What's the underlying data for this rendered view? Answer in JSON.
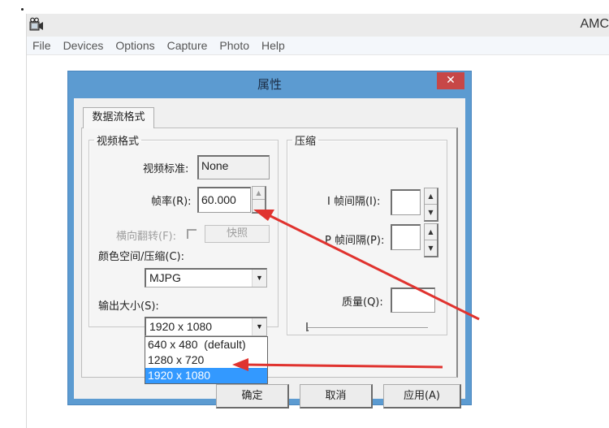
{
  "app": {
    "title": "AMC",
    "menu": [
      "File",
      "Devices",
      "Options",
      "Capture",
      "Photo",
      "Help"
    ]
  },
  "dialog": {
    "title": "属性",
    "close_label": "✕",
    "tab_label": "数据流格式",
    "video_group": {
      "legend": "视频格式",
      "standard_label": "视频标准:",
      "standard_value": "None",
      "framerate_label": "帧率(R):",
      "framerate_value": "60.000",
      "flip_label": "横向翻转(F):",
      "snapshot_label": "快照",
      "colorspace_label": "颜色空间/压缩(C):",
      "colorspace_value": "MJPG",
      "output_size_label": "输出大小(S):",
      "output_size_value": "1920 x 1080",
      "output_size_options": [
        "640 x 480  (default)",
        "1280 x 720",
        "1920 x 1080"
      ],
      "output_size_selected_index": 2
    },
    "compression_group": {
      "legend": "压缩",
      "i_frame_label": "I 帧间隔(I):",
      "i_frame_value": "",
      "p_frame_label": "P 帧间隔(P):",
      "p_frame_value": "",
      "quality_label": "质量(Q):",
      "quality_value": "",
      "quality_slider_fraction": 0.0
    },
    "buttons": {
      "ok": "确定",
      "cancel": "取消",
      "apply": "应用(A)"
    }
  },
  "annotation": {
    "arrow_color": "#e0332f"
  }
}
